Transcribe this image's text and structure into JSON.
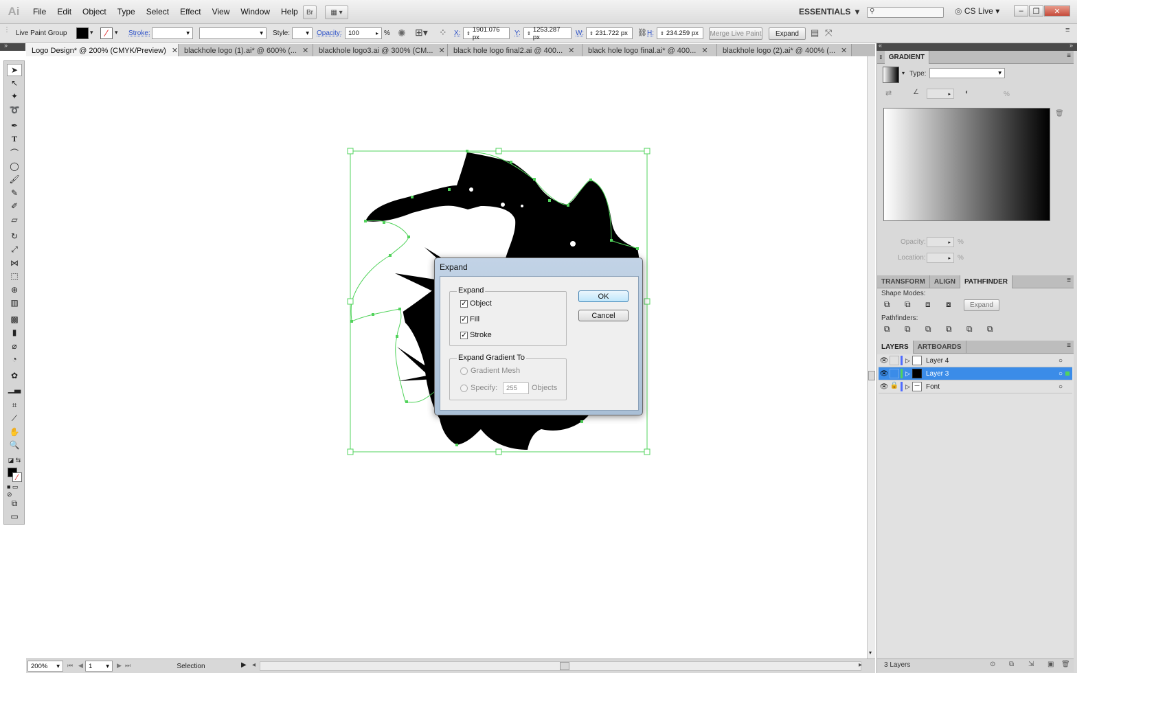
{
  "app": {
    "logo": "Ai",
    "workspace": "ESSENTIALS",
    "cs_live": "CS Live"
  },
  "menu": [
    "File",
    "Edit",
    "Object",
    "Type",
    "Select",
    "Effect",
    "View",
    "Window",
    "Help"
  ],
  "menubar_buttons": {
    "bridge": "Br"
  },
  "control_bar": {
    "object_type": "Live Paint Group",
    "stroke_label": "Stroke:",
    "style_label": "Style:",
    "opacity_label": "Opacity:",
    "opacity_value": "100",
    "opacity_unit": "%",
    "x_label": "X:",
    "x_value": "1901.076 px",
    "y_label": "Y:",
    "y_value": "1253.287 px",
    "w_label": "W:",
    "w_value": "231.722 px",
    "h_label": "H:",
    "h_value": "234.259 px",
    "merge_label": "Merge Live Paint",
    "expand_label": "Expand"
  },
  "tabs": [
    {
      "label": "Logo Design* @ 200% (CMYK/Preview)",
      "active": true
    },
    {
      "label": "blackhole logo (1).ai* @ 600% (...",
      "active": false
    },
    {
      "label": "blackhole logo3.ai @ 300% (CM...",
      "active": false
    },
    {
      "label": "black hole logo final2.ai @ 400...",
      "active": false
    },
    {
      "label": "black hole logo final.ai* @ 400...",
      "active": false
    },
    {
      "label": "blackhole logo (2).ai* @ 400% (...",
      "active": false
    }
  ],
  "status_bar": {
    "zoom": "200%",
    "page": "1",
    "tool": "Selection"
  },
  "gradient_panel": {
    "title": "GRADIENT",
    "type_label": "Type:",
    "type_value": "",
    "angle_unit": "%",
    "opacity_label": "Opacity:",
    "location_label": "Location:",
    "opacity_unit": "%",
    "location_unit": "%"
  },
  "pathfinder_panel": {
    "tabs": [
      "TRANSFORM",
      "ALIGN",
      "PATHFINDER"
    ],
    "shape_modes_label": "Shape Modes:",
    "expand_label": "Expand",
    "pathfinders_label": "Pathfinders:"
  },
  "layers_panel": {
    "tabs": [
      "LAYERS",
      "ARTBOARDS"
    ],
    "layers": [
      {
        "name": "Layer 4",
        "color": "#4f6bff",
        "selected": false,
        "locked": false
      },
      {
        "name": "Layer 3",
        "color": "#52d35c",
        "selected": true,
        "locked": false
      },
      {
        "name": "Font",
        "color": "#4f6bff",
        "selected": false,
        "locked": true
      }
    ],
    "footer": "3 Layers"
  },
  "dialog": {
    "title": "Expand",
    "expand_group": "Expand",
    "options": [
      {
        "label": "Object",
        "checked": true
      },
      {
        "label": "Fill",
        "checked": true
      },
      {
        "label": "Stroke",
        "checked": true
      }
    ],
    "gradient_group": "Expand Gradient To",
    "gradient_mesh": "Gradient Mesh",
    "specify": "Specify:",
    "specify_value": "255",
    "objects_label": "Objects",
    "ok": "OK",
    "cancel": "Cancel"
  },
  "colors": {
    "selection": "#52d35c",
    "layer_highlight": "#3b8ce8",
    "link": "#2a4fc7"
  }
}
